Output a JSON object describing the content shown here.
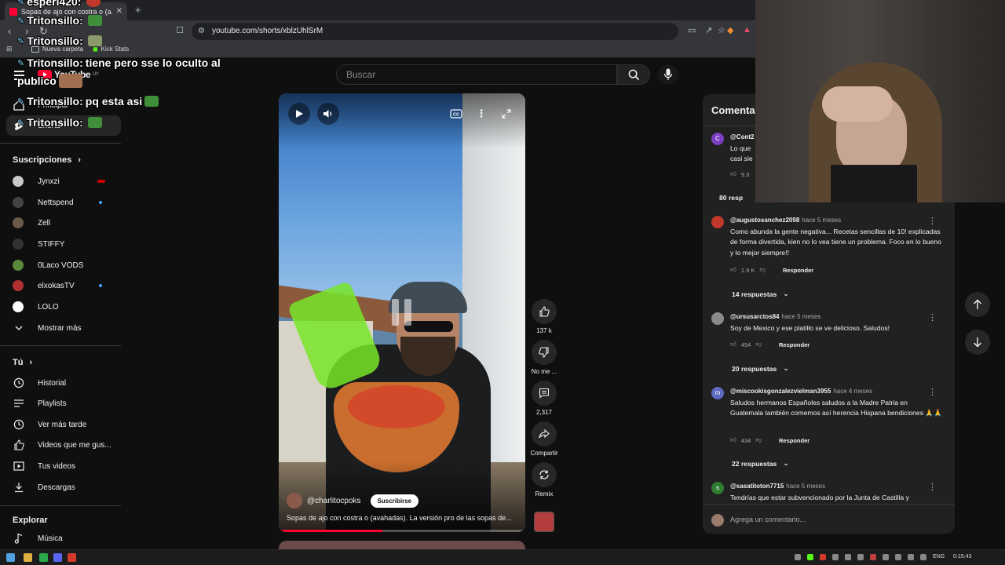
{
  "browser": {
    "tab_title": "Sopas de ajo con costra o (a...",
    "new_tab": "+",
    "url": "youtube.com/shorts/xblzUhlSrM",
    "bookmarks": [
      {
        "label": "Nueva carpeta"
      },
      {
        "label": "Kick Stats"
      }
    ]
  },
  "masthead": {
    "logo_text": "YouTube",
    "country": "UY",
    "search_placeholder": "Buscar"
  },
  "chat_overlay": [
    {
      "user": "esperi420:",
      "message": ""
    },
    {
      "user": "Tritonsillo:",
      "message": ""
    },
    {
      "user": "Tritonsillo:",
      "message": ""
    },
    {
      "user": "Tritonsillo:",
      "message": "tiene pero sse lo oculto al"
    },
    {
      "user": "",
      "message": "publico"
    },
    {
      "user": "Tritonsillo:",
      "message": "pq esta asi"
    },
    {
      "user": "Tritonsillo:",
      "message": ""
    }
  ],
  "sidebar": {
    "top_items": [
      {
        "label": "Principal",
        "icon": "home-icon"
      },
      {
        "label": "Shorts",
        "icon": "shorts-icon"
      }
    ],
    "subscriptions_header": "Suscripciones",
    "channels": [
      {
        "name": "Jynxzi",
        "color": "#c8c8c8",
        "status": "live"
      },
      {
        "name": "Nettspend",
        "color": "#444444",
        "status": "new"
      },
      {
        "name": "Zell",
        "color": "#6a5a4a",
        "status": ""
      },
      {
        "name": "STIFFY",
        "color": "#333333",
        "status": ""
      },
      {
        "name": "0Laco VODS",
        "color": "#5a8a3a",
        "status": ""
      },
      {
        "name": "elxokasTV",
        "color": "#b03030",
        "status": "new"
      },
      {
        "name": "LOLO",
        "color": "#ffffff",
        "status": ""
      }
    ],
    "show_more": "Mostrar más",
    "you_header": "Tú",
    "you_items": [
      {
        "label": "Historial",
        "icon": "history-icon"
      },
      {
        "label": "Playlists",
        "icon": "playlists-icon"
      },
      {
        "label": "Ver más tarde",
        "icon": "watch-later-icon"
      },
      {
        "label": "Videos que me gus...",
        "icon": "liked-icon"
      },
      {
        "label": "Tus videos",
        "icon": "your-videos-icon"
      },
      {
        "label": "Descargas",
        "icon": "downloads-icon"
      }
    ],
    "explore_header": "Explorar",
    "explore_items": [
      {
        "label": "Música",
        "icon": "music-icon"
      }
    ]
  },
  "video": {
    "channel": "@charlitocpoks",
    "subscribe": "Suscribirse",
    "title": "Sopas de ajo con costra o (avahadas). La versión pro de las sopas de...",
    "progress": 0.42
  },
  "actions": {
    "likes": "137 k",
    "dislike": "No me ...",
    "comments": "2,317",
    "share": "Compartir",
    "remix": "Remix"
  },
  "comments_panel": {
    "header": "Comentar",
    "input_placeholder": "Agrega un comentario...",
    "comments": [
      {
        "avatar_letter": "C",
        "avatar_color": "#7b3fc1",
        "author": "@Cont2",
        "time": "",
        "text": "Lo que\ncasi sie",
        "likes": "9.3",
        "reply": "",
        "replies": "80 resp"
      },
      {
        "avatar_letter": "",
        "avatar_color": "#c0392b",
        "author": "@augustosanchez2098",
        "time": "hace 5 meses",
        "text": "Como abunda la gente negativa... Recetas sencillas de 10! explicadas de forma divertida, kien no lo vea tiene un problema. Foco en lo bueno y lo mejor siempre!!",
        "likes": "1.9 K",
        "reply": "Responder",
        "replies": "14 respuestas"
      },
      {
        "avatar_letter": "",
        "avatar_color": "#8a8a8a",
        "author": "@ursusarctos84",
        "time": "hace 5 meses",
        "text": "Soy de Mexico y ese platillo se ve delicioso. Saludos!",
        "likes": "454",
        "reply": "Responder",
        "replies": "20 respuestas"
      },
      {
        "avatar_letter": "m",
        "avatar_color": "#5c6bc0",
        "author": "@miscookisgonzalezvielman3955",
        "time": "hace 4 meses",
        "text": "Saludos hermanos Españoles saludos a la Madre Patria en Guatemala también comemos así herencia Hispana bendiciones 🙏🙏",
        "likes": "434",
        "reply": "Responder",
        "replies": "22 respuestas"
      },
      {
        "avatar_letter": "s",
        "avatar_color": "#2e7d32",
        "author": "@sasatitoton7715",
        "time": "hace 5 meses",
        "text": "Tendrías que estar subvencionado por la Junta de Castilla y",
        "likes": "",
        "reply": "",
        "replies": ""
      }
    ]
  },
  "taskbar": {
    "language": "ENG",
    "time": "0:15:43"
  }
}
